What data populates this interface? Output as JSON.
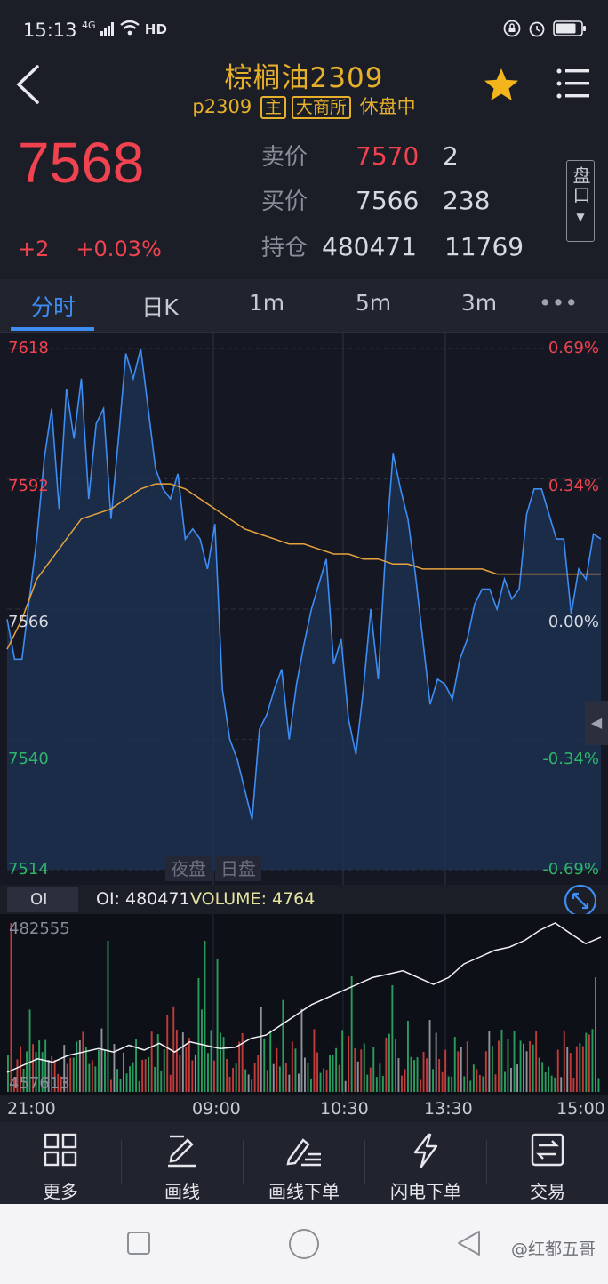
{
  "status": {
    "time": "15:13",
    "network": "4G",
    "hd": "HD"
  },
  "header": {
    "title": "棕榈油2309",
    "code": "p2309",
    "main_badge": "主",
    "exchange_badge": "大商所",
    "session_status": "休盘中"
  },
  "quote": {
    "last_price": "7568",
    "change": "+2",
    "change_pct": "+0.03%",
    "ask_label": "卖价",
    "ask_price": "7570",
    "ask_volume": "2",
    "bid_label": "买价",
    "bid_price": "7566",
    "bid_volume": "238",
    "oi_label": "持仓",
    "open_interest": "480471",
    "oi_change": "11769",
    "panel_button": "盘口"
  },
  "tabs": [
    {
      "label": "分时",
      "active": true
    },
    {
      "label": "日K"
    },
    {
      "label": "1m"
    },
    {
      "label": "5m"
    },
    {
      "label": "3m"
    },
    {
      "label": "•••"
    }
  ],
  "chart_data": [
    {
      "type": "line",
      "title": "",
      "y_ticks": [
        "7618",
        "7592",
        "7566",
        "7540",
        "7514"
      ],
      "y_pct_ticks": [
        "0.69%",
        "0.34%",
        "0.00%",
        "-0.34%",
        "-0.69%"
      ],
      "ylim": [
        7514,
        7618
      ],
      "base_price": 7566,
      "session_labels": [
        "夜盘",
        "日盘"
      ],
      "series": [
        {
          "values": [
            7564,
            7556,
            7556,
            7568,
            7580,
            7596,
            7606,
            7586,
            7610,
            7600,
            7612,
            7588,
            7603,
            7606,
            7584,
            7600,
            7617,
            7612,
            7618,
            7606,
            7594,
            7590,
            7588,
            7593,
            7580,
            7582,
            7580,
            7574,
            7583,
            7550,
            7540,
            7536,
            7530,
            7524,
            7542,
            7545,
            7550,
            7554,
            7540,
            7551,
            7559,
            7566,
            7571,
            7576,
            7555,
            7560,
            7544,
            7537,
            7550,
            7566,
            7552,
            7578,
            7597,
            7590,
            7584,
            7573,
            7560,
            7547,
            7552,
            7551,
            7548,
            7556,
            7560,
            7567,
            7570,
            7570,
            7566,
            7572,
            7568,
            7570,
            7585,
            7590,
            7590,
            7585,
            7580,
            7580,
            7565,
            7574,
            7572,
            7581,
            7580
          ]
        },
        {
          "values": [
            7558,
            7564,
            7572,
            7576,
            7580,
            7584,
            7585,
            7586,
            7588,
            7590,
            7591,
            7591,
            7590,
            7588,
            7586,
            7584,
            7582,
            7581,
            7580,
            7579,
            7579,
            7578,
            7577,
            7577,
            7576,
            7576,
            7575,
            7575,
            7574,
            7574,
            7574,
            7574,
            7574,
            7573,
            7573,
            7573,
            7573,
            7573,
            7573,
            7573,
            7573
          ]
        }
      ]
    },
    {
      "type": "bar",
      "title": "",
      "oi_selector": "OI",
      "oi_text": "OI: 480471",
      "volume_text": "VOLUME: 4764",
      "y_max_label": "482555",
      "y_min_label": "457613",
      "x_ticks": [
        "21:00",
        "09:00",
        "10:30",
        "13:30",
        "15:00"
      ],
      "series": [
        {
          "values": [
            460500,
            461500,
            462500,
            462000,
            463000,
            463500,
            464000,
            463500,
            464500,
            463800,
            464800,
            463500,
            465000,
            464500,
            464000,
            464200,
            465500,
            466000,
            467500,
            469000,
            470500,
            471500,
            472500,
            473500,
            474500,
            475000,
            475500,
            474500,
            473500,
            474500,
            476500,
            477500,
            478500,
            479000,
            480000,
            481500,
            482555,
            481000,
            479500,
            480471
          ]
        }
      ]
    }
  ],
  "toolbar": [
    {
      "label": "更多",
      "icon": "grid-icon"
    },
    {
      "label": "画线",
      "icon": "draw-line-icon"
    },
    {
      "label": "画线下单",
      "icon": "draw-order-icon"
    },
    {
      "label": "闪电下单",
      "icon": "lightning-icon"
    },
    {
      "label": "交易",
      "icon": "trade-icon"
    }
  ],
  "watermark": "@红都五哥",
  "colors": {
    "up": "#f1434f",
    "down": "#2fb56b",
    "accent": "#e6b02b",
    "price_line": "#3d8df3",
    "avg_line": "#e8a33c"
  }
}
